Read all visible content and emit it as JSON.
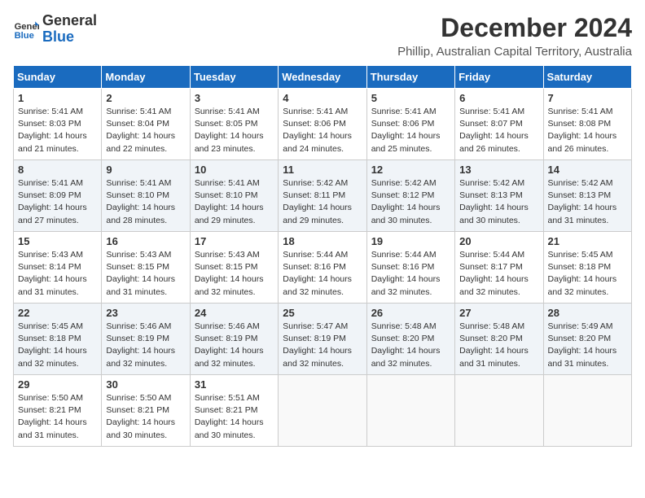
{
  "header": {
    "logo_line1": "General",
    "logo_line2": "Blue",
    "title": "December 2024",
    "subtitle": "Phillip, Australian Capital Territory, Australia"
  },
  "weekdays": [
    "Sunday",
    "Monday",
    "Tuesday",
    "Wednesday",
    "Thursday",
    "Friday",
    "Saturday"
  ],
  "weeks": [
    [
      {
        "day": 1,
        "sunrise": "5:41 AM",
        "sunset": "8:03 PM",
        "daylight": "14 hours and 21 minutes."
      },
      {
        "day": 2,
        "sunrise": "5:41 AM",
        "sunset": "8:04 PM",
        "daylight": "14 hours and 22 minutes."
      },
      {
        "day": 3,
        "sunrise": "5:41 AM",
        "sunset": "8:05 PM",
        "daylight": "14 hours and 23 minutes."
      },
      {
        "day": 4,
        "sunrise": "5:41 AM",
        "sunset": "8:06 PM",
        "daylight": "14 hours and 24 minutes."
      },
      {
        "day": 5,
        "sunrise": "5:41 AM",
        "sunset": "8:06 PM",
        "daylight": "14 hours and 25 minutes."
      },
      {
        "day": 6,
        "sunrise": "5:41 AM",
        "sunset": "8:07 PM",
        "daylight": "14 hours and 26 minutes."
      },
      {
        "day": 7,
        "sunrise": "5:41 AM",
        "sunset": "8:08 PM",
        "daylight": "14 hours and 26 minutes."
      }
    ],
    [
      {
        "day": 8,
        "sunrise": "5:41 AM",
        "sunset": "8:09 PM",
        "daylight": "14 hours and 27 minutes."
      },
      {
        "day": 9,
        "sunrise": "5:41 AM",
        "sunset": "8:10 PM",
        "daylight": "14 hours and 28 minutes."
      },
      {
        "day": 10,
        "sunrise": "5:41 AM",
        "sunset": "8:10 PM",
        "daylight": "14 hours and 29 minutes."
      },
      {
        "day": 11,
        "sunrise": "5:42 AM",
        "sunset": "8:11 PM",
        "daylight": "14 hours and 29 minutes."
      },
      {
        "day": 12,
        "sunrise": "5:42 AM",
        "sunset": "8:12 PM",
        "daylight": "14 hours and 30 minutes."
      },
      {
        "day": 13,
        "sunrise": "5:42 AM",
        "sunset": "8:13 PM",
        "daylight": "14 hours and 30 minutes."
      },
      {
        "day": 14,
        "sunrise": "5:42 AM",
        "sunset": "8:13 PM",
        "daylight": "14 hours and 31 minutes."
      }
    ],
    [
      {
        "day": 15,
        "sunrise": "5:43 AM",
        "sunset": "8:14 PM",
        "daylight": "14 hours and 31 minutes."
      },
      {
        "day": 16,
        "sunrise": "5:43 AM",
        "sunset": "8:15 PM",
        "daylight": "14 hours and 31 minutes."
      },
      {
        "day": 17,
        "sunrise": "5:43 AM",
        "sunset": "8:15 PM",
        "daylight": "14 hours and 32 minutes."
      },
      {
        "day": 18,
        "sunrise": "5:44 AM",
        "sunset": "8:16 PM",
        "daylight": "14 hours and 32 minutes."
      },
      {
        "day": 19,
        "sunrise": "5:44 AM",
        "sunset": "8:16 PM",
        "daylight": "14 hours and 32 minutes."
      },
      {
        "day": 20,
        "sunrise": "5:44 AM",
        "sunset": "8:17 PM",
        "daylight": "14 hours and 32 minutes."
      },
      {
        "day": 21,
        "sunrise": "5:45 AM",
        "sunset": "8:18 PM",
        "daylight": "14 hours and 32 minutes."
      }
    ],
    [
      {
        "day": 22,
        "sunrise": "5:45 AM",
        "sunset": "8:18 PM",
        "daylight": "14 hours and 32 minutes."
      },
      {
        "day": 23,
        "sunrise": "5:46 AM",
        "sunset": "8:19 PM",
        "daylight": "14 hours and 32 minutes."
      },
      {
        "day": 24,
        "sunrise": "5:46 AM",
        "sunset": "8:19 PM",
        "daylight": "14 hours and 32 minutes."
      },
      {
        "day": 25,
        "sunrise": "5:47 AM",
        "sunset": "8:19 PM",
        "daylight": "14 hours and 32 minutes."
      },
      {
        "day": 26,
        "sunrise": "5:48 AM",
        "sunset": "8:20 PM",
        "daylight": "14 hours and 32 minutes."
      },
      {
        "day": 27,
        "sunrise": "5:48 AM",
        "sunset": "8:20 PM",
        "daylight": "14 hours and 31 minutes."
      },
      {
        "day": 28,
        "sunrise": "5:49 AM",
        "sunset": "8:20 PM",
        "daylight": "14 hours and 31 minutes."
      }
    ],
    [
      {
        "day": 29,
        "sunrise": "5:50 AM",
        "sunset": "8:21 PM",
        "daylight": "14 hours and 31 minutes."
      },
      {
        "day": 30,
        "sunrise": "5:50 AM",
        "sunset": "8:21 PM",
        "daylight": "14 hours and 30 minutes."
      },
      {
        "day": 31,
        "sunrise": "5:51 AM",
        "sunset": "8:21 PM",
        "daylight": "14 hours and 30 minutes."
      },
      null,
      null,
      null,
      null
    ]
  ]
}
